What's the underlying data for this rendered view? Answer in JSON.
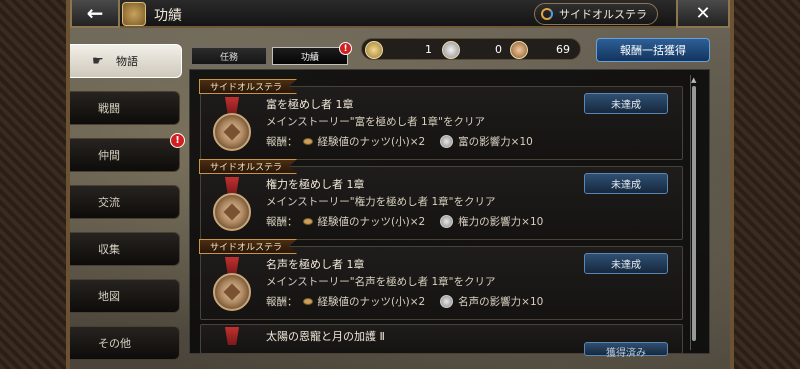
{
  "header": {
    "title": "功績",
    "back_glyph": "←",
    "close_glyph": "✕",
    "side_badge_label": "サイドオルステラ"
  },
  "sidebar": {
    "items": [
      {
        "label": "物語",
        "active": true,
        "alert": false
      },
      {
        "label": "戦闘",
        "active": false,
        "alert": false
      },
      {
        "label": "仲間",
        "active": false,
        "alert": true
      },
      {
        "label": "交流",
        "active": false,
        "alert": false
      },
      {
        "label": "収集",
        "active": false,
        "alert": false
      },
      {
        "label": "地図",
        "active": false,
        "alert": false
      },
      {
        "label": "その他",
        "active": false,
        "alert": false
      }
    ]
  },
  "tabs": [
    {
      "label": "任務",
      "active": false,
      "alert": false
    },
    {
      "label": "功績",
      "active": true,
      "alert": true
    }
  ],
  "alert_glyph": "!",
  "counters": [
    {
      "icon": "gold-medal-icon",
      "value": "1"
    },
    {
      "icon": "silver-medal-icon",
      "value": "0"
    },
    {
      "icon": "bronze-medal-icon",
      "value": "69"
    }
  ],
  "claim_all_label": "報酬一括獲得",
  "achievements": [
    {
      "ribbon": "サイドオルステラ",
      "title": "富を極めし者 1章",
      "description": "メインストーリー\"富を極めし者 1章\"をクリア",
      "reward_label": "報酬：",
      "reward_1": "経験値のナッツ(小)×2",
      "reward_2": "富の影響力×10",
      "status": "未達成"
    },
    {
      "ribbon": "サイドオルステラ",
      "title": "権力を極めし者 1章",
      "description": "メインストーリー\"権力を極めし者 1章\"をクリア",
      "reward_label": "報酬：",
      "reward_1": "経験値のナッツ(小)×2",
      "reward_2": "権力の影響力×10",
      "status": "未達成"
    },
    {
      "ribbon": "サイドオルステラ",
      "title": "名声を極めし者 1章",
      "description": "メインストーリー\"名声を極めし者 1章\"をクリア",
      "reward_label": "報酬：",
      "reward_1": "経験値のナッツ(小)×2",
      "reward_2": "名声の影響力×10",
      "status": "未達成"
    },
    {
      "title": "太陽の恩寵と月の加護 Ⅱ",
      "status": "獲得済み"
    }
  ],
  "colors": {
    "accent_blue": "#2d5f96",
    "ribbon_gold": "#c8964a",
    "alert_red": "#d02020"
  }
}
